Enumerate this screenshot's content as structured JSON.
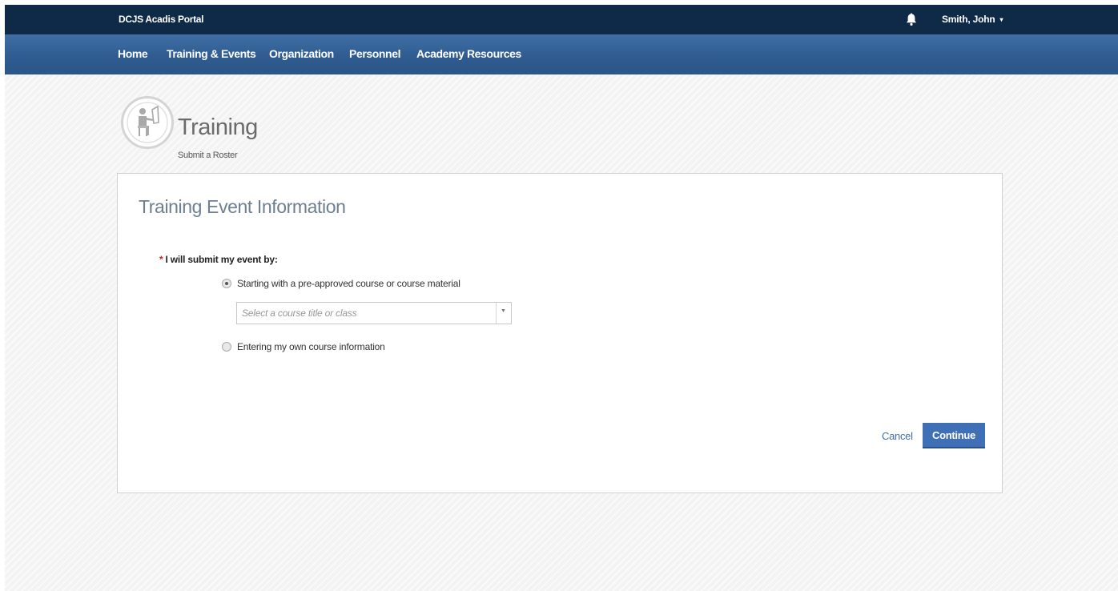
{
  "topbar": {
    "brand": "DCJS Acadis Portal",
    "bell_icon": "bell-icon",
    "user_name": "Smith, John",
    "user_caret": "▾"
  },
  "nav": {
    "items": [
      {
        "label": "Home"
      },
      {
        "label": "Training & Events"
      },
      {
        "label": "Organization"
      },
      {
        "label": "Personnel"
      },
      {
        "label": "Academy Resources"
      }
    ]
  },
  "header": {
    "icon": "training-person-icon",
    "title": "Training",
    "subtitle": "Submit a Roster"
  },
  "form": {
    "title": "Training Event Information",
    "required_marker": "*",
    "question": "I will submit my event by:",
    "options": [
      {
        "label": "Starting with a pre-approved course or course material",
        "checked": true
      },
      {
        "label": "Entering my own course information",
        "checked": false
      }
    ],
    "course_select": {
      "placeholder": "Select a course title or class",
      "arrow": "▼"
    },
    "cancel_label": "Cancel",
    "continue_label": "Continue"
  },
  "colors": {
    "topbar": "#0f2a47",
    "navbar": "#2f5c90",
    "accent": "#3f6fb5",
    "required": "#cc2222"
  }
}
